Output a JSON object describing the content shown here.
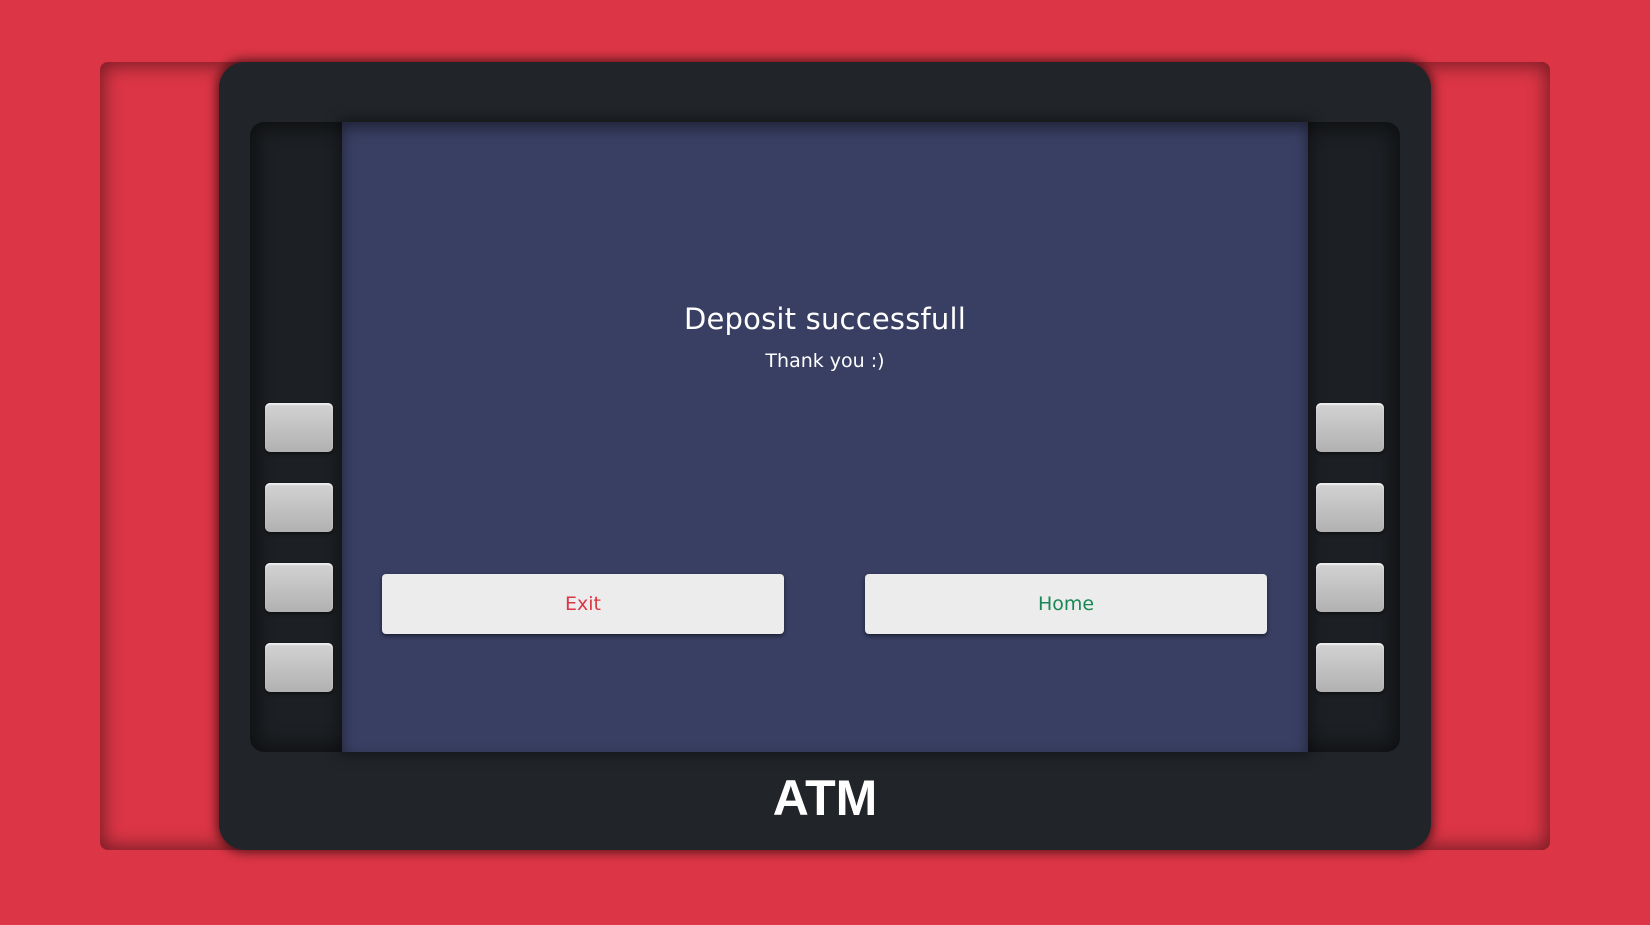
{
  "screen": {
    "title": "Deposit successfull",
    "subtitle": "Thank you :)",
    "exit_label": "Exit",
    "home_label": "Home"
  },
  "brand": {
    "label": "ATM"
  },
  "colors": {
    "background": "#dc3545",
    "atm_body": "#212529",
    "screen": "#393f63",
    "button": "#ececec",
    "exit_text": "#dc3545",
    "home_text": "#198754",
    "side_key": "#c4c4c4"
  }
}
